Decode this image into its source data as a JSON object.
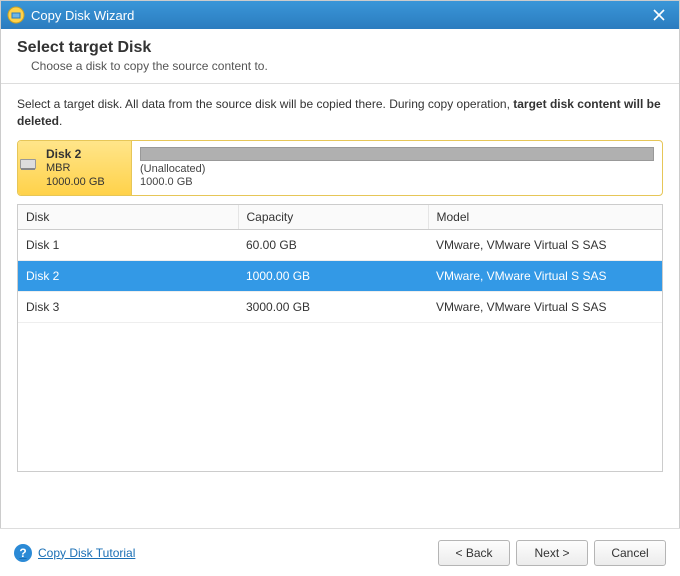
{
  "window": {
    "title": "Copy Disk Wizard"
  },
  "header": {
    "title": "Select target Disk",
    "subtitle": "Choose a disk to copy the source content to."
  },
  "instruction": {
    "prefix": "Select a target disk. All data from the source disk will be copied there. During copy operation, ",
    "bold": "target disk content will be deleted",
    "suffix": "."
  },
  "selected_disk": {
    "name": "Disk 2",
    "scheme": "MBR",
    "size": "1000.00 GB",
    "partition_label": "(Unallocated)",
    "partition_size": "1000.0 GB"
  },
  "table": {
    "columns": {
      "disk": "Disk",
      "capacity": "Capacity",
      "model": "Model"
    },
    "rows": [
      {
        "disk": "Disk 1",
        "capacity": "60.00 GB",
        "model": "VMware, VMware Virtual S SAS",
        "selected": false
      },
      {
        "disk": "Disk 2",
        "capacity": "1000.00 GB",
        "model": "VMware, VMware Virtual S SAS",
        "selected": true
      },
      {
        "disk": "Disk 3",
        "capacity": "3000.00 GB",
        "model": "VMware, VMware Virtual S SAS",
        "selected": false
      }
    ]
  },
  "footer": {
    "help_link": "Copy Disk Tutorial",
    "back": "< Back",
    "next": "Next >",
    "cancel": "Cancel"
  }
}
